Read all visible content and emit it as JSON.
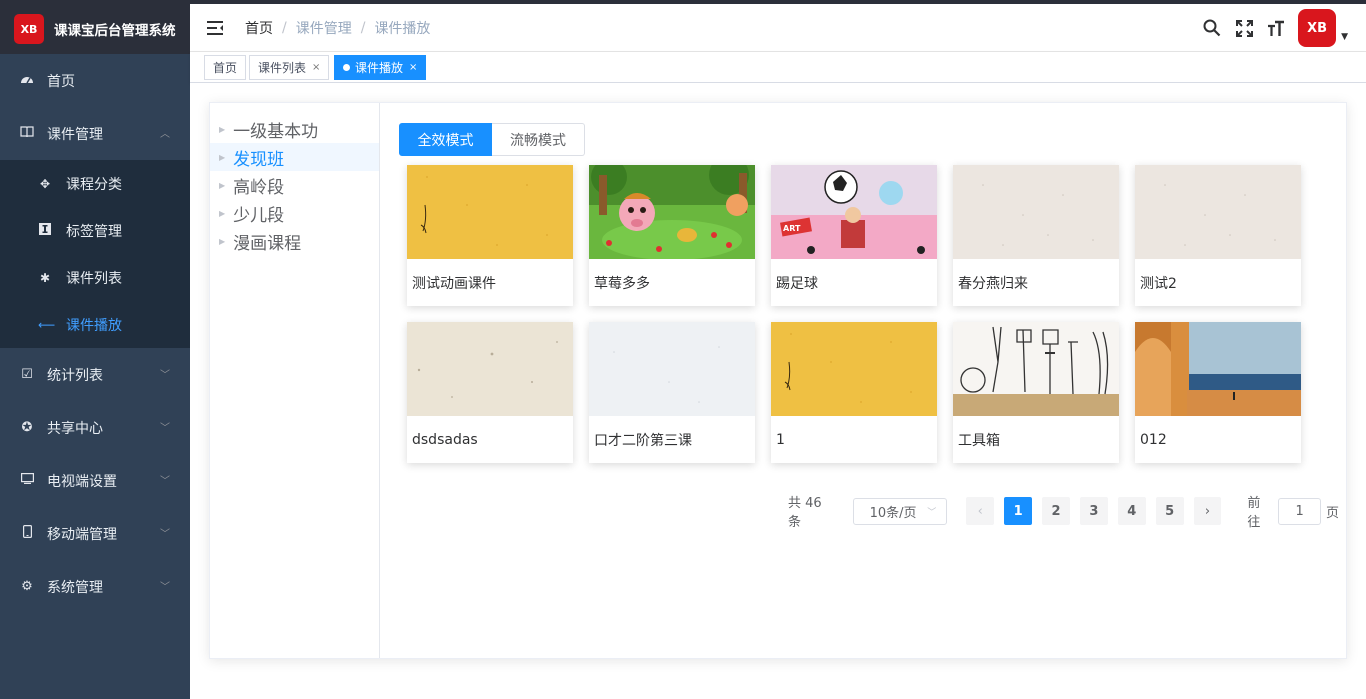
{
  "brand": {
    "logo_text": "XB",
    "title": "课课宝后台管理系统"
  },
  "sidebar": {
    "items": [
      {
        "label": "首页",
        "icon": "dashboard-icon"
      },
      {
        "label": "课件管理",
        "icon": "book-icon",
        "expanded": true,
        "children": [
          {
            "label": "课程分类",
            "icon": "puzzle-icon"
          },
          {
            "label": "标签管理",
            "icon": "tag-icon"
          },
          {
            "label": "课件列表",
            "icon": "bug-icon"
          },
          {
            "label": "课件播放",
            "icon": "arrow-icon",
            "active": true
          }
        ]
      },
      {
        "label": "统计列表",
        "icon": "checkbox-icon"
      },
      {
        "label": "共享中心",
        "icon": "share-icon"
      },
      {
        "label": "电视端设置",
        "icon": "tv-icon"
      },
      {
        "label": "移动端管理",
        "icon": "mobile-icon"
      },
      {
        "label": "系统管理",
        "icon": "gear-icon"
      }
    ]
  },
  "breadcrumb": [
    "首页",
    "课件管理",
    "课件播放"
  ],
  "navbar": {
    "avatar_text": "XB",
    "icons": [
      "search-icon",
      "fullscreen-icon",
      "font-size-icon"
    ]
  },
  "tags": [
    {
      "label": "首页",
      "closable": false
    },
    {
      "label": "课件列表",
      "closable": true
    },
    {
      "label": "课件播放",
      "closable": true,
      "active": true
    }
  ],
  "tree": {
    "nodes": [
      {
        "label": "一级基本功"
      },
      {
        "label": "发现班",
        "active": true
      },
      {
        "label": "高岭段"
      },
      {
        "label": "少儿段"
      },
      {
        "label": "漫画课程"
      }
    ]
  },
  "mode": {
    "full": "全效模式",
    "smooth": "流畅模式",
    "active": "全效模式"
  },
  "courses": [
    {
      "title": "测试动画课件",
      "thumb": "yellow-paper"
    },
    {
      "title": "草莓多多",
      "thumb": "cartoon-forest"
    },
    {
      "title": "踢足球",
      "thumb": "football-collage"
    },
    {
      "title": "春分燕归来",
      "thumb": "beige-paper"
    },
    {
      "title": "测试2",
      "thumb": "beige-paper"
    },
    {
      "title": "dsdsadas",
      "thumb": "cream-paper"
    },
    {
      "title": "口才二阶第三课",
      "thumb": "white-paper"
    },
    {
      "title": "1",
      "thumb": "yellow-paper"
    },
    {
      "title": "工具箱",
      "thumb": "tools-sketch"
    },
    {
      "title": "012",
      "thumb": "orange-arch"
    }
  ],
  "pagination": {
    "total_text": "共 46 条",
    "page_size": "10条/页",
    "pages": [
      "1",
      "2",
      "3",
      "4",
      "5"
    ],
    "current": "1",
    "goto_label": "前往",
    "goto_value": "1",
    "goto_suffix": "页"
  },
  "colors": {
    "primary": "#1890ff",
    "sidebar_bg": "#304156",
    "submenu_bg": "#1f2d3d",
    "brand_red": "#d9161d"
  }
}
